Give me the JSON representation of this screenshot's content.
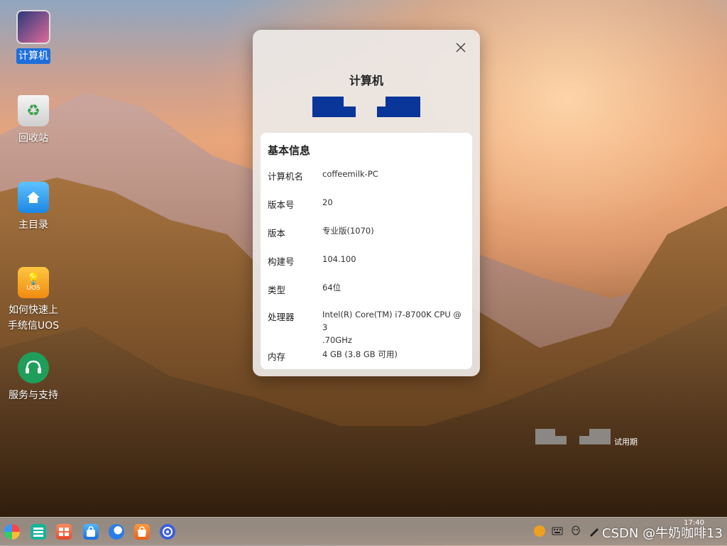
{
  "desktop": {
    "icons": [
      {
        "label": "计算机"
      },
      {
        "label": "回收站"
      },
      {
        "label": "主目录"
      },
      {
        "label": "如何快速上\n手统信UOS",
        "badge": "UOS"
      },
      {
        "label": "服务与支持"
      }
    ]
  },
  "dialog": {
    "title": "计算机",
    "section_title": "基本信息",
    "rows": [
      {
        "key": "计算机名",
        "value": "coffeemilk-PC"
      },
      {
        "key": "版本号",
        "value": "20"
      },
      {
        "key": "版本",
        "value": "专业版(1070)"
      },
      {
        "key": "构建号",
        "value": "104.100"
      },
      {
        "key": "类型",
        "value": "64位"
      },
      {
        "key": "处理器",
        "value": "Intel(R) Core(TM) i7-8700K CPU @ 3\n.70GHz"
      },
      {
        "key": "内存",
        "value": "4 GB (3.8 GB 可用)"
      }
    ],
    "logo_color": "#0a3599"
  },
  "watermark": {
    "trial_text": "试用期"
  },
  "taskbar": {
    "apps": [
      "launcher-icon",
      "multitask-icon",
      "file-manager-icon",
      "app-store-icon",
      "browser-icon",
      "deepin-store-icon",
      "settings-icon"
    ],
    "tray": [
      "uos-account-icon",
      "keyboard-icon",
      "qq-icon",
      "pen-icon"
    ],
    "clock": "17:40",
    "overlay_text": "CSDN @牛奶咖啡13"
  },
  "colors": {
    "selection": "#1e6fd9",
    "logo_blue": "#0a3599"
  }
}
